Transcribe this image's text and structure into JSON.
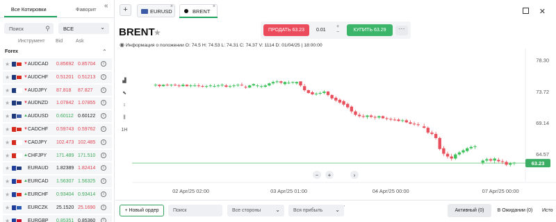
{
  "left_panel": {
    "tabs": [
      "Все Котировки",
      "Фаворит"
    ],
    "search_placeholder": "Поиск",
    "filter_value": "ВСЕ",
    "columns": [
      "Инструмент",
      "Bid",
      "Ask"
    ],
    "group": "Forex",
    "collapse_label": "«",
    "rows": [
      {
        "symbol": "AUDCAD",
        "bid": "0.85692",
        "ask": "0.85704",
        "bid_color": "#e0414f",
        "ask_color": "#e0414f",
        "dir": "▼",
        "flags": [
          "#1f3a7a",
          "#d52b1e"
        ]
      },
      {
        "symbol": "AUDCHF",
        "bid": "0.51201",
        "ask": "0.51213",
        "bid_color": "#e0414f",
        "ask_color": "#e0414f",
        "dir": "▼",
        "flags": [
          "#1f3a7a",
          "#d52b1e"
        ]
      },
      {
        "symbol": "AUDJPY",
        "bid": "87.818",
        "ask": "87.827",
        "bid_color": "#e0414f",
        "ask_color": "#e0414f",
        "dir": "▼",
        "flags": [
          "#1f3a7a",
          "#ffffff"
        ]
      },
      {
        "symbol": "AUDNZD",
        "bid": "1.07842",
        "ask": "1.07855",
        "bid_color": "#e0414f",
        "ask_color": "#e0414f",
        "dir": "▼",
        "flags": [
          "#1f3a7a",
          "#1f3a7a"
        ]
      },
      {
        "symbol": "AUDUSD",
        "bid": "0.60112",
        "ask": "0.60122",
        "bid_color": "#3aa857",
        "ask_color": "#222222",
        "dir": "▲",
        "flags": [
          "#1f3a7a",
          "#3c5aa6"
        ]
      },
      {
        "symbol": "CADCHF",
        "bid": "0.59743",
        "ask": "0.59762",
        "bid_color": "#e0414f",
        "ask_color": "#e0414f",
        "dir": "▼",
        "flags": [
          "#d52b1e",
          "#d52b1e"
        ]
      },
      {
        "symbol": "CADJPY",
        "bid": "102.473",
        "ask": "102.485",
        "bid_color": "#e0414f",
        "ask_color": "#e0414f",
        "dir": "▼",
        "flags": [
          "#d52b1e",
          "#ffffff"
        ]
      },
      {
        "symbol": "CHFJPY",
        "bid": "171.489",
        "ask": "171.510",
        "bid_color": "#3aa857",
        "ask_color": "#3aa857",
        "dir": "▲",
        "flags": [
          "#d52b1e",
          "#ffffff"
        ]
      },
      {
        "symbol": "EURAUD",
        "bid": "1.82389",
        "ask": "1.82414",
        "bid_color": "#222222",
        "ask_color": "#e0414f",
        "dir": "",
        "flags": [
          "#1f3f9a",
          "#1f3a7a"
        ]
      },
      {
        "symbol": "EURCAD",
        "bid": "1.56307",
        "ask": "1.56325",
        "bid_color": "#3aa857",
        "ask_color": "#3aa857",
        "dir": "▲",
        "flags": [
          "#1f3f9a",
          "#d52b1e"
        ]
      },
      {
        "symbol": "EURCHF",
        "bid": "0.93404",
        "ask": "0.93414",
        "bid_color": "#3aa857",
        "ask_color": "#3aa857",
        "dir": "▲",
        "flags": [
          "#1f3f9a",
          "#d52b1e"
        ]
      },
      {
        "symbol": "EURCZK",
        "bid": "25.1520",
        "ask": "25.1690",
        "bid_color": "#222222",
        "ask_color": "#e0414f",
        "dir": "",
        "flags": [
          "#1f3f9a",
          "#2a5ab0"
        ]
      },
      {
        "symbol": "EURGBP",
        "bid": "0.85351",
        "ask": "0.85360",
        "bid_color": "#3aa857",
        "ask_color": "#222222",
        "dir": "",
        "flags": [
          "#1f3f9a",
          "#c8102e"
        ]
      }
    ]
  },
  "top_bar": {
    "add_tab": "+",
    "tabs": [
      {
        "label": "EURUSD",
        "close": "×"
      },
      {
        "label": "BRENT",
        "close": "×"
      }
    ]
  },
  "header": {
    "title": "BRENT",
    "sell_label": "ПРОДАТЬ 63.23",
    "quantity": "0.01",
    "buy_label": "КУПИТЬ 63.29",
    "more": "···",
    "info": "Информация о положении   O: 74.5   H: 74.53   L: 74.31   C: 74.37   V: 1114   D: 01/04/25 | 18:00:00"
  },
  "chart_data": {
    "type": "candlestick",
    "y_ticks": [
      "78.30",
      "73.72",
      "69.14",
      "64.57"
    ],
    "ylim": [
      60.5,
      80.0
    ],
    "x_ticks": [
      "02 Apr/25 02:00",
      "03 Apr/25 01:00",
      "04 Apr/25 00:00",
      "07 Apr/25 00:00"
    ],
    "current_price": "63.23",
    "current_price_value": 63.23,
    "up_color": "#3cc15a",
    "down_color": "#e7505c",
    "candles": [
      [
        74.6,
        74.9,
        74.4,
        74.7
      ],
      [
        74.7,
        74.8,
        74.3,
        74.5
      ],
      [
        74.5,
        74.8,
        74.4,
        74.7
      ],
      [
        74.7,
        74.9,
        74.5,
        74.6
      ],
      [
        74.6,
        74.8,
        74.4,
        74.7
      ],
      [
        74.7,
        74.9,
        74.5,
        74.6
      ],
      [
        74.6,
        74.8,
        74.3,
        74.5
      ],
      [
        74.5,
        74.9,
        74.4,
        74.7
      ],
      [
        74.7,
        74.8,
        74.4,
        74.5
      ],
      [
        74.5,
        74.8,
        74.3,
        74.6
      ],
      [
        74.6,
        74.9,
        74.4,
        74.6
      ],
      [
        74.6,
        74.9,
        74.3,
        74.5
      ],
      [
        74.5,
        74.7,
        74.3,
        74.4
      ],
      [
        74.4,
        74.7,
        74.2,
        74.5
      ],
      [
        74.5,
        74.8,
        74.3,
        74.6
      ],
      [
        74.5,
        74.8,
        74.3,
        74.5
      ],
      [
        74.5,
        74.8,
        74.3,
        74.6
      ],
      [
        74.6,
        74.9,
        74.4,
        74.7
      ],
      [
        74.6,
        74.8,
        74.3,
        74.4
      ],
      [
        74.4,
        74.7,
        74.2,
        74.5
      ],
      [
        74.5,
        74.8,
        74.3,
        74.6
      ],
      [
        74.6,
        74.9,
        74.4,
        74.7
      ],
      [
        74.7,
        75.0,
        74.5,
        74.6
      ],
      [
        74.4,
        74.6,
        74.1,
        74.3
      ],
      [
        74.3,
        74.7,
        74.2,
        74.6
      ],
      [
        74.6,
        74.9,
        74.5,
        74.8
      ],
      [
        74.5,
        74.8,
        74.3,
        74.6
      ],
      [
        74.4,
        74.7,
        74.2,
        74.5
      ],
      [
        74.4,
        74.8,
        74.3,
        74.6
      ],
      [
        74.6,
        75.0,
        74.5,
        74.9
      ],
      [
        74.9,
        75.3,
        74.7,
        75.1
      ],
      [
        75.1,
        75.4,
        74.9,
        75.2
      ],
      [
        75.2,
        75.3,
        74.8,
        75.0
      ],
      [
        74.8,
        75.2,
        74.6,
        75.1
      ],
      [
        74.9,
        75.3,
        74.8,
        75.0
      ],
      [
        75.0,
        75.2,
        74.8,
        75.1
      ],
      [
        74.9,
        75.2,
        74.7,
        75.1
      ],
      [
        75.2,
        75.0,
        74.4,
        74.6
      ],
      [
        74.5,
        74.8,
        73.7,
        73.9
      ],
      [
        73.9,
        74.0,
        73.4,
        73.5
      ],
      [
        73.6,
        73.8,
        73.2,
        73.3
      ],
      [
        73.3,
        73.6,
        73.1,
        73.4
      ],
      [
        73.4,
        73.7,
        73.2,
        73.5
      ],
      [
        73.5,
        73.9,
        73.3,
        73.7
      ],
      [
        73.7,
        73.8,
        73.0,
        73.2
      ],
      [
        73.2,
        73.3,
        72.5,
        72.7
      ],
      [
        72.8,
        73.0,
        72.2,
        72.4
      ],
      [
        72.5,
        72.7,
        71.9,
        72.1
      ],
      [
        72.3,
        72.5,
        71.6,
        71.8
      ],
      [
        71.9,
        72.1,
        71.2,
        71.4
      ],
      [
        71.5,
        71.7,
        70.5,
        70.8
      ],
      [
        70.8,
        71.0,
        70.1,
        70.3
      ],
      [
        70.3,
        70.6,
        69.9,
        70.1
      ],
      [
        70.1,
        70.4,
        69.8,
        70.0
      ],
      [
        70.0,
        70.3,
        69.7,
        70.2
      ],
      [
        70.2,
        70.4,
        69.8,
        70.0
      ],
      [
        70.0,
        70.2,
        69.6,
        69.9
      ],
      [
        69.9,
        70.2,
        69.7,
        70.1
      ],
      [
        70.1,
        70.2,
        69.7,
        69.8
      ],
      [
        69.8,
        70.0,
        69.5,
        69.7
      ],
      [
        69.7,
        69.9,
        69.4,
        69.6
      ],
      [
        69.6,
        69.9,
        69.4,
        69.5
      ],
      [
        69.6,
        69.8,
        69.3,
        69.4
      ],
      [
        69.4,
        69.7,
        69.2,
        69.5
      ],
      [
        69.5,
        69.7,
        69.1,
        69.2
      ],
      [
        69.2,
        69.5,
        68.9,
        69.0
      ],
      [
        69.0,
        69.3,
        68.7,
        68.9
      ],
      [
        68.9,
        69.2,
        68.6,
        68.8
      ],
      [
        68.6,
        69.0,
        68.3,
        68.4
      ],
      [
        68.4,
        68.6,
        67.5,
        67.7
      ],
      [
        67.7,
        68.0,
        67.3,
        67.5
      ],
      [
        67.5,
        67.8,
        66.7,
        66.9
      ],
      [
        66.9,
        67.1,
        65.1,
        65.3
      ],
      [
        65.4,
        65.7,
        64.3,
        64.6
      ],
      [
        64.6,
        64.9,
        63.9,
        64.2
      ],
      [
        64.2,
        64.6,
        63.6,
        63.9
      ],
      [
        63.9,
        64.7,
        63.7,
        64.5
      ],
      [
        64.5,
        65.0,
        64.3,
        64.8
      ],
      [
        64.8,
        65.3,
        64.6,
        65.1
      ],
      [
        65.0,
        65.6,
        64.8,
        65.4
      ],
      [
        65.4,
        65.8,
        65.2,
        65.6
      ],
      [
        65.6,
        65.9,
        65.3,
        65.7
      ],
      [
        63.3,
        63.8,
        63.0,
        63.6
      ],
      [
        63.6,
        64.0,
        63.4,
        63.8
      ],
      [
        63.8,
        64.0,
        63.4,
        63.6
      ],
      [
        63.6,
        64.1,
        63.2,
        63.9
      ],
      [
        63.7,
        64.0,
        63.3,
        63.5
      ],
      [
        63.5,
        63.8,
        63.1,
        63.4
      ],
      [
        63.4,
        63.6,
        62.8,
        63.0
      ],
      [
        63.0,
        63.4,
        62.7,
        63.2
      ],
      [
        63.2,
        63.4,
        62.9,
        63.3
      ]
    ],
    "candle_x": [
      0.06,
      0.07,
      0.08,
      0.09,
      0.1,
      0.11,
      0.12,
      0.13,
      0.14,
      0.15,
      0.16,
      0.17,
      0.18,
      0.19,
      0.2,
      0.21,
      0.22,
      0.23,
      0.24,
      0.25,
      0.26,
      0.27,
      0.28,
      0.29,
      0.3,
      0.31,
      0.32,
      0.33,
      0.34,
      0.35,
      0.36,
      0.37,
      0.38,
      0.39,
      0.4,
      0.41,
      0.42,
      0.43,
      0.44,
      0.45,
      0.46,
      0.47,
      0.48,
      0.49,
      0.5,
      0.51,
      0.52,
      0.53,
      0.54,
      0.55,
      0.56,
      0.57,
      0.58,
      0.59,
      0.6,
      0.61,
      0.62,
      0.63,
      0.64,
      0.65,
      0.66,
      0.67,
      0.68,
      0.69,
      0.7,
      0.71,
      0.72,
      0.73,
      0.745,
      0.755,
      0.765,
      0.775,
      0.785,
      0.795,
      0.805,
      0.815,
      0.825,
      0.835,
      0.845,
      0.855,
      0.865,
      0.875,
      0.895,
      0.905,
      0.915,
      0.925,
      0.935,
      0.945,
      0.955,
      0.965,
      0.975
    ],
    "tools": [
      "▟",
      "⬉",
      "↕",
      "⫼",
      "1H"
    ],
    "scroll_controls": [
      "−",
      "+",
      "›"
    ]
  },
  "bottom_bar": {
    "new_order": "+ Новый ордер",
    "search_placeholder": "Поиск",
    "side_filter": "Все стороны",
    "profit_filter": "Вся прибыль",
    "tabs": [
      "Активный (0)",
      "В Ожидании (0)",
      "Исто"
    ],
    "grip": "⌄"
  }
}
